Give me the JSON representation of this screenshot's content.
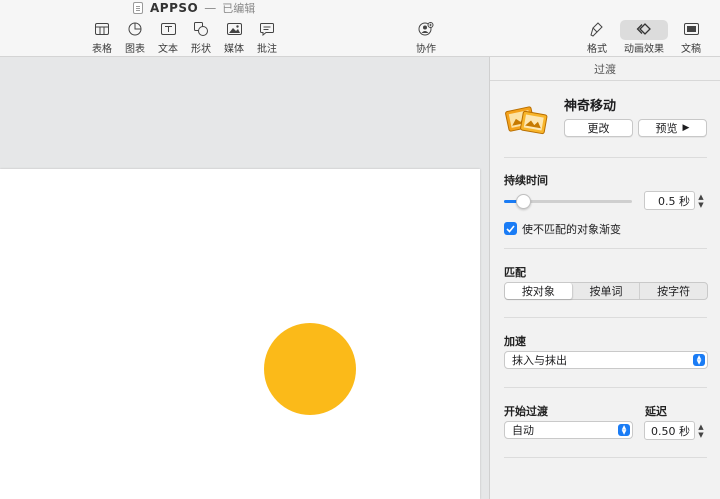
{
  "window": {
    "doc_name": "APPSO",
    "doc_separator": "—",
    "doc_state": "已编辑"
  },
  "toolbar": {
    "left_items": [
      {
        "label": "表格",
        "icon": "table-icon"
      },
      {
        "label": "图表",
        "icon": "chart-icon"
      },
      {
        "label": "文本",
        "icon": "text-box-icon"
      },
      {
        "label": "形状",
        "icon": "shape-icon"
      },
      {
        "label": "媒体",
        "icon": "media-icon"
      },
      {
        "label": "批注",
        "icon": "comment-icon"
      }
    ],
    "collaborate_label": "协作",
    "right_items": [
      {
        "label": "格式",
        "icon": "format-brush-icon"
      },
      {
        "label": "动画效果",
        "icon": "animate-icon"
      },
      {
        "label": "文稿",
        "icon": "document-icon"
      }
    ]
  },
  "inspector": {
    "header": "过渡",
    "effect": {
      "name": "神奇移动",
      "change_label": "更改",
      "preview_label": "预览",
      "preview_icon": "play-icon"
    },
    "duration": {
      "label": "持续时间",
      "value": "0.5 秒",
      "slider_fraction": 0.15
    },
    "fade_mismatch": {
      "label": "使不匹配的对象渐变",
      "checked": true
    },
    "match": {
      "label": "匹配",
      "options": [
        "按对象",
        "按单词",
        "按字符"
      ],
      "selected": 0
    },
    "acceleration": {
      "label": "加速",
      "value": "抹入与抹出"
    },
    "start": {
      "label": "开始过渡",
      "value": "自动"
    },
    "delay": {
      "label": "延迟",
      "value": "0.50 秒"
    }
  },
  "colors": {
    "accent": "#1a7cf5",
    "sun": "#fbba19"
  }
}
